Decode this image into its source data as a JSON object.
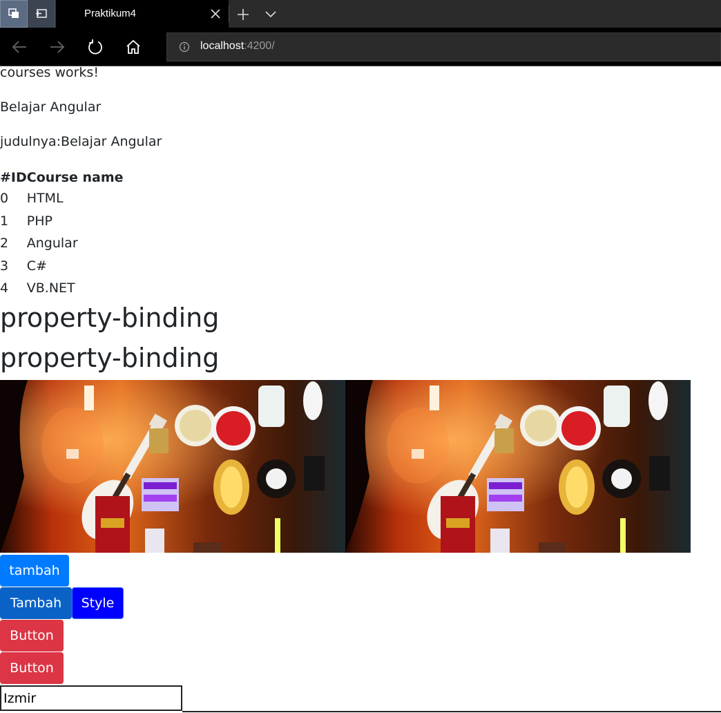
{
  "browser": {
    "tab_title": "Praktikum4",
    "address_host": "localhost",
    "address_rest": ":4200/"
  },
  "page": {
    "works_text": "courses works!",
    "title_text": "Belajar Angular",
    "judul_text": "judulnya:Belajar Angular",
    "table": {
      "headers": [
        "#ID",
        "Course name"
      ],
      "rows": [
        {
          "id": "0",
          "name": "HTML"
        },
        {
          "id": "1",
          "name": "PHP"
        },
        {
          "id": "2",
          "name": "Angular"
        },
        {
          "id": "3",
          "name": "C#"
        },
        {
          "id": "4",
          "name": "VB.NET"
        }
      ]
    },
    "heading_1": "property-binding",
    "heading_2": "property-binding",
    "buttons": {
      "tambah_lower": "tambah",
      "tambah_upper": "Tambah",
      "style": "Style",
      "button_1": "Button",
      "button_2": "Button"
    },
    "input_value": "Izmir",
    "images": {
      "image_1_alt": "",
      "image_2_alt": ""
    }
  },
  "colors": {
    "primary": "#007bff",
    "primary_dark": "#0a62c7",
    "style_blue": "#0000ff",
    "danger": "#dc3545"
  }
}
